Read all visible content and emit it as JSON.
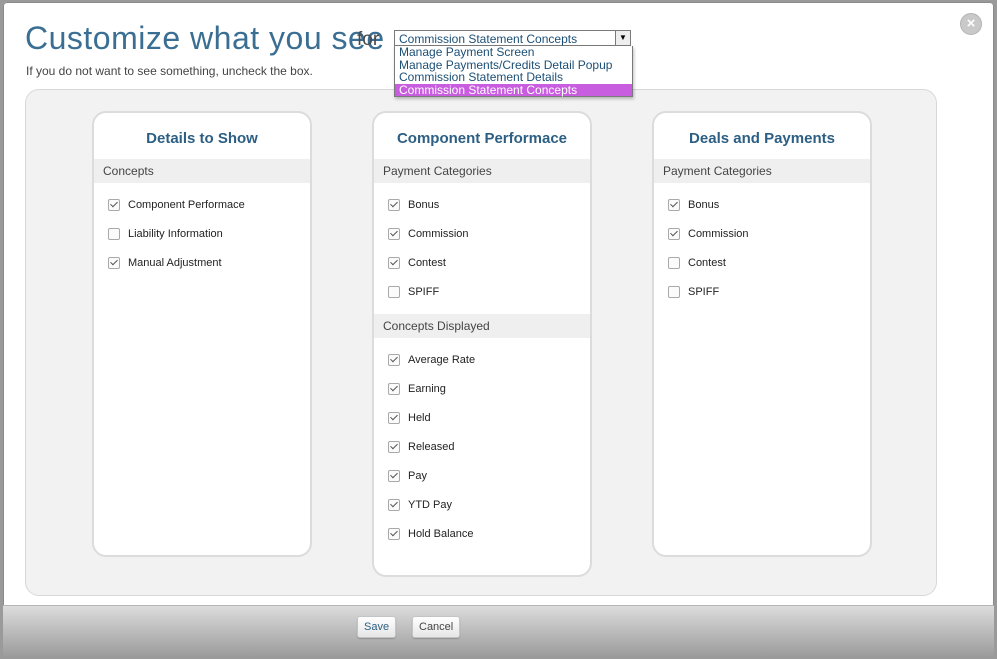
{
  "dialog": {
    "title": "Customize what you see",
    "for_label": "for",
    "subtitle": "If you do not want to see something, uncheck the box.",
    "close_icon": "close-icon"
  },
  "view_select": {
    "value": "Commission Statement Concepts",
    "options": [
      {
        "label": "Manage Payment Screen",
        "selected": false
      },
      {
        "label": "Manage Payments/Credits Detail Popup",
        "selected": false
      },
      {
        "label": "Commission Statement Details",
        "selected": false
      },
      {
        "label": "Commission Statement Concepts",
        "selected": true
      }
    ]
  },
  "cards": [
    {
      "title": "Details to Show",
      "sections": [
        {
          "header": "Concepts",
          "items": [
            {
              "label": "Component Performace",
              "checked": true
            },
            {
              "label": "Liability Information",
              "checked": false
            },
            {
              "label": "Manual Adjustment",
              "checked": true
            }
          ]
        }
      ]
    },
    {
      "title": "Component Performace",
      "sections": [
        {
          "header": "Payment Categories",
          "items": [
            {
              "label": "Bonus",
              "checked": true
            },
            {
              "label": "Commission",
              "checked": true
            },
            {
              "label": "Contest",
              "checked": true
            },
            {
              "label": "SPIFF",
              "checked": false
            }
          ]
        },
        {
          "header": "Concepts Displayed",
          "items": [
            {
              "label": "Average Rate",
              "checked": true
            },
            {
              "label": "Earning",
              "checked": true
            },
            {
              "label": "Held",
              "checked": true
            },
            {
              "label": "Released",
              "checked": true
            },
            {
              "label": "Pay",
              "checked": true
            },
            {
              "label": "YTD Pay",
              "checked": true
            },
            {
              "label": "Hold Balance",
              "checked": true
            }
          ]
        }
      ]
    },
    {
      "title": "Deals and Payments",
      "sections": [
        {
          "header": "Payment Categories",
          "items": [
            {
              "label": "Bonus",
              "checked": true
            },
            {
              "label": "Commission",
              "checked": true
            },
            {
              "label": "Contest",
              "checked": false
            },
            {
              "label": "SPIFF",
              "checked": false
            }
          ]
        }
      ]
    }
  ],
  "footer": {
    "save_label": "Save",
    "cancel_label": "Cancel"
  },
  "colors": {
    "title": "#3a6f93",
    "card_title": "#2c5f83",
    "selected_option": "#c95de0"
  }
}
